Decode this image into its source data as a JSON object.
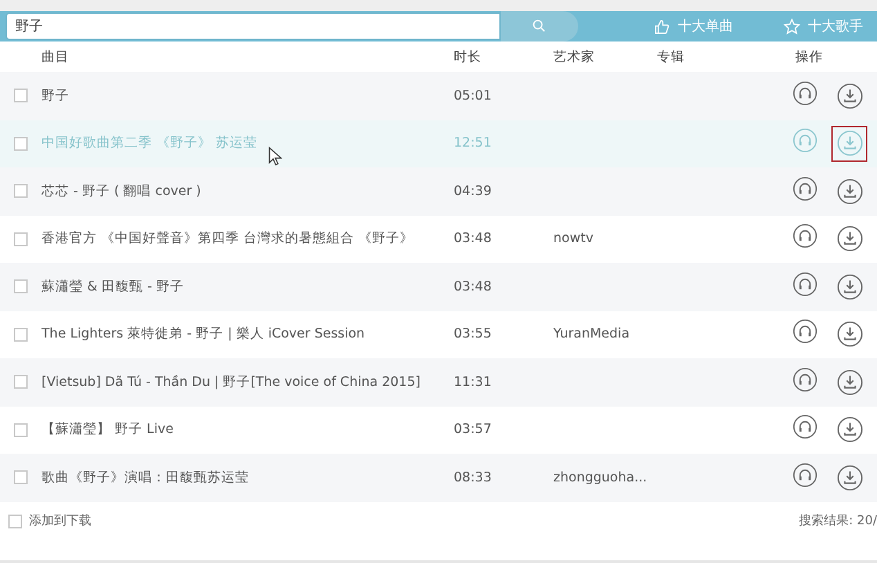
{
  "toolbar": {
    "search": {
      "value": "野子"
    },
    "links": [
      {
        "label": "十大单曲",
        "kind": "thumb"
      },
      {
        "label": "十大歌手",
        "kind": "star"
      }
    ]
  },
  "table": {
    "columns": [
      "曲目",
      "时长",
      "艺术家",
      "专辑",
      "操作"
    ],
    "rows": [
      {
        "title": "野子",
        "duration": "05:01",
        "checked": false,
        "selected": false,
        "highlighted": false
      },
      {
        "title": "中国好歌曲第二季 《野子》 苏运莹",
        "duration": "12:51",
        "checked": false,
        "selected": true,
        "highlighted": true
      },
      {
        "title": "芯芯 - 野子 ( 翻唱 cover )",
        "duration": "04:39",
        "checked": false,
        "selected": false,
        "highlighted": false
      },
      {
        "title": "香港官方 《中国好聲音》第四季  台灣求的暑態組合 《野子》",
        "duration": "03:48",
        "artist": "nowtv",
        "checked": false,
        "selected": false,
        "highlighted": false
      },
      {
        "title": "蘇瀟瑩 & 田馥甄 - 野子",
        "duration": "03:48",
        "checked": false,
        "selected": false,
        "highlighted": false
      },
      {
        "title": "The Lighters 萊特徙弟 - 野子 | 樂人 iCover Session",
        "duration": "03:55",
        "artist": "YuranMedia",
        "checked": false,
        "selected": false,
        "highlighted": false
      },
      {
        "title": "[Vietsub] Dã Tú - Thần Du | 野子[The voice of China 2015]",
        "duration": "11:31",
        "checked": false,
        "selected": false,
        "highlighted": false
      },
      {
        "title": "【蘇瀟瑩】 野子 Live",
        "duration": "03:57",
        "checked": false,
        "selected": false,
        "highlighted": false
      },
      {
        "title": "歌曲《野子》演唱：田馥甄苏运莹",
        "duration": "08:33",
        "artist": "zhongguoha...",
        "checked": false,
        "selected": false,
        "highlighted": false
      }
    ]
  },
  "footer": {
    "add_to_download": {
      "label": "添加到下载",
      "checked": false
    },
    "result": "搜索结果: 20/"
  }
}
